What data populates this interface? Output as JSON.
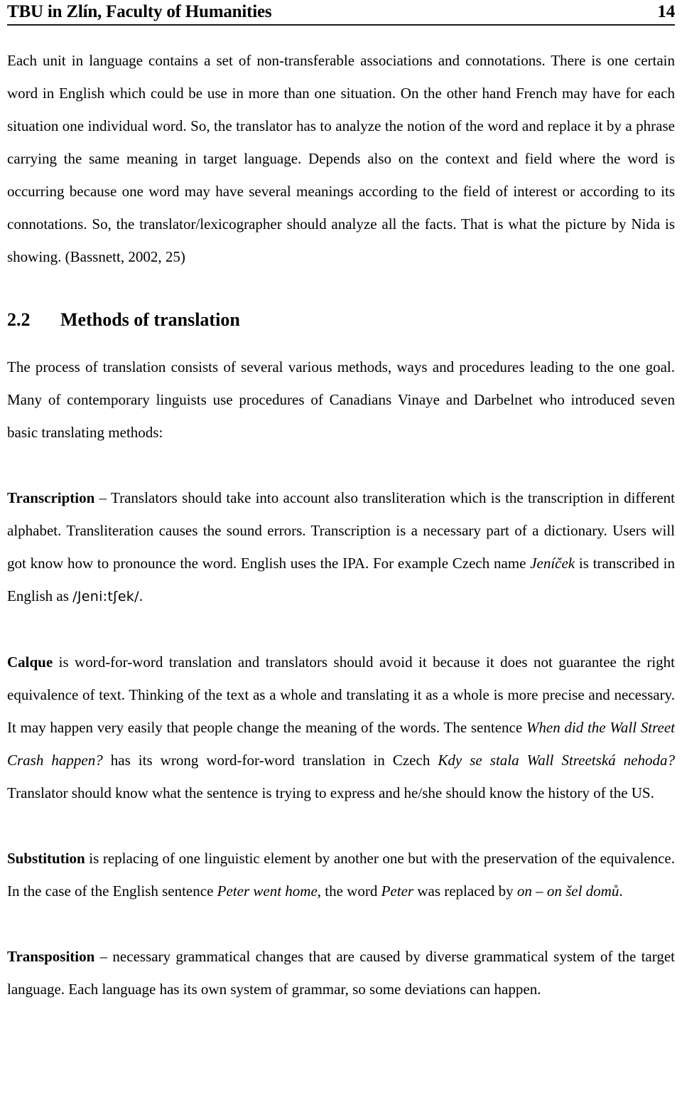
{
  "header": {
    "title": "TBU in Zlín, Faculty of Humanities",
    "page_number": "14"
  },
  "body": {
    "paragraph_1": {
      "text": "Each unit in language contains a set of non-transferable associations and connotations. There is one certain word in English which could be use in more than one situation. On the other hand French may have for each situation one individual word. So, the translator has to analyze the notion of the word and replace it by a phrase carrying the same meaning in target language. Depends also on the context and field where the word is occurring because one word may have several meanings according to the field of interest or according to its connotations. So, the translator/lexicographer should analyze all the facts. That is what the picture by Nida is showing. (Bassnett, 2002, 25)"
    },
    "section": {
      "number": "2.2",
      "title": "Methods of translation"
    },
    "paragraph_2": {
      "text": "The process of translation consists of several various methods, ways and procedures leading to the one goal. Many of contemporary linguists use procedures of Canadians Vinaye and Darbelnet who introduced seven basic translating methods:"
    },
    "method_transcription": {
      "term": "Transcription",
      "part1": " – Translators should take into account also transliteration which is the transcription in different alphabet. Transliteration causes the sound errors. Transcription is a necessary part of a dictionary. Users will got know how to pronounce the word. English uses the IPA. For example Czech name ",
      "italic1": "Jeníček",
      "part2": " is transcribed in English as ",
      "ipa": "/Jeni:tʃek/",
      "part3": "."
    },
    "method_calque": {
      "term": "Calque",
      "part1": " is word-for-word translation and translators should avoid it because it does not guarantee the right equivalence of text. Thinking of the text as a whole and translating it as a whole is more precise and necessary. It may happen very easily that people change the meaning of the words. The sentence ",
      "italic1": "When did the Wall Street Crash happen?",
      "part2": " has its wrong word-for-word translation in Czech ",
      "italic2": "Kdy se stala Wall Streetská nehoda?",
      "part3": " Translator should know what the sentence is trying to express and he/she should know the history of the US."
    },
    "method_substitution": {
      "term": "Substitution",
      "part1": " is replacing of one linguistic element by another one but with the preservation of the equivalence. In the case of the English sentence ",
      "italic1": "Peter went home",
      "part2": ", the word ",
      "italic2": "Peter",
      "part3": " was replaced by ",
      "italic3": "on – on šel domů",
      "part4": "."
    },
    "method_transposition": {
      "term": "Transposition",
      "part1": " – necessary grammatical changes that are caused by diverse grammatical system of the target language. Each language has its own system of grammar, so some deviations can happen."
    }
  }
}
